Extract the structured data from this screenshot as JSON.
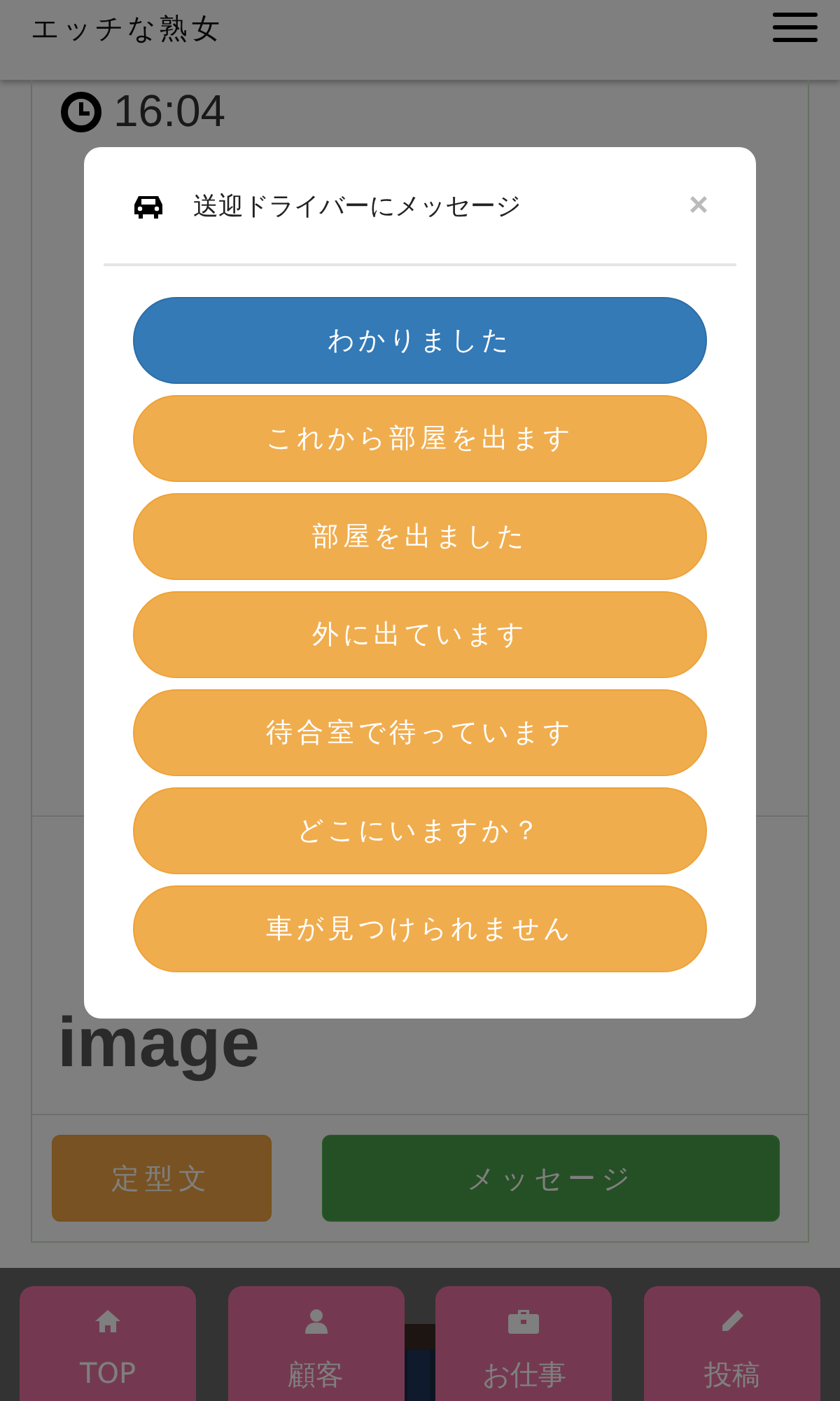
{
  "header": {
    "title": "エッチな熟女"
  },
  "content": {
    "time": "16:04",
    "image_text": "image"
  },
  "actions": [
    {
      "label": "定型文",
      "kind": "warning"
    },
    {
      "label": "メッセージ",
      "kind": "success"
    }
  ],
  "nav": [
    {
      "label": "TOP",
      "kind": "home"
    },
    {
      "label": "顧客",
      "kind": "user"
    },
    {
      "label": "お仕事",
      "kind": "briefcase"
    },
    {
      "label": "投稿",
      "kind": "pencil"
    }
  ],
  "modal": {
    "title": "送迎ドライバーにメッセージ",
    "close": "×",
    "buttons": [
      {
        "label": "わかりました",
        "kind": "primary"
      },
      {
        "label": "これから部屋を出ます",
        "kind": "warning"
      },
      {
        "label": "部屋を出ました",
        "kind": "warning"
      },
      {
        "label": "外に出ています",
        "kind": "warning"
      },
      {
        "label": "待合室で待っています",
        "kind": "warning"
      },
      {
        "label": "どこにいますか？",
        "kind": "warning"
      },
      {
        "label": "車が見つけられません",
        "kind": "warning"
      }
    ]
  }
}
